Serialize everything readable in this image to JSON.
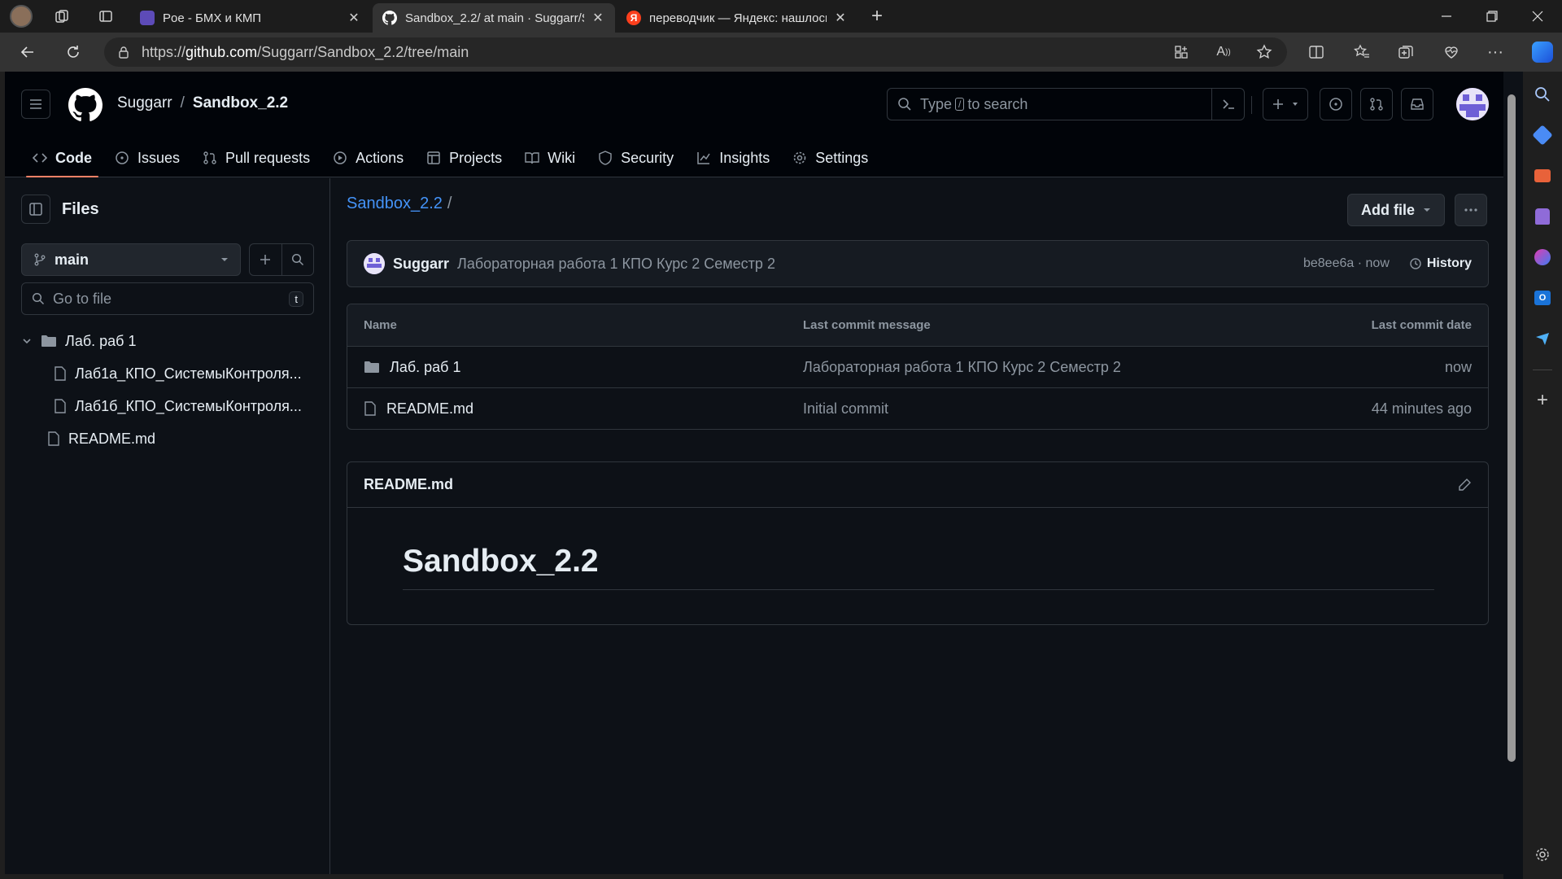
{
  "browser": {
    "tabs": [
      {
        "title": "Poe - БМХ и КМП",
        "favicon": "poe-icon",
        "active": false
      },
      {
        "title": "Sandbox_2.2/ at main · Suggarr/Sa",
        "favicon": "github-icon",
        "active": true
      },
      {
        "title": "переводчик — Яндекс: нашлось",
        "favicon": "yandex-icon",
        "active": false
      }
    ],
    "url_prefix": "https://",
    "url_host": "github.com",
    "url_path": "/Suggarr/Sandbox_2.2/tree/main"
  },
  "header": {
    "owner": "Suggarr",
    "separator": "/",
    "repo": "Sandbox_2.2",
    "search_prefix": "Type",
    "search_key": "/",
    "search_suffix": "to search"
  },
  "repo_nav": [
    {
      "label": "Code",
      "icon": "code-icon",
      "active": true
    },
    {
      "label": "Issues",
      "icon": "issue-icon"
    },
    {
      "label": "Pull requests",
      "icon": "pull-request-icon"
    },
    {
      "label": "Actions",
      "icon": "play-icon"
    },
    {
      "label": "Projects",
      "icon": "table-icon"
    },
    {
      "label": "Wiki",
      "icon": "book-icon"
    },
    {
      "label": "Security",
      "icon": "shield-icon"
    },
    {
      "label": "Insights",
      "icon": "graph-icon"
    },
    {
      "label": "Settings",
      "icon": "gear-icon"
    }
  ],
  "file_tree": {
    "title": "Files",
    "branch": "main",
    "goto_placeholder": "Go to file",
    "goto_key": "t",
    "items": [
      {
        "label": "Лаб. раб 1",
        "type": "folder",
        "expanded": true
      },
      {
        "label": "Лаб1а_КПО_СистемыКонтроля...",
        "type": "file"
      },
      {
        "label": "Лаб1б_КПО_СистемыКонтроля...",
        "type": "file"
      },
      {
        "label": "README.md",
        "type": "file"
      }
    ]
  },
  "main": {
    "breadcrumb_repo": "Sandbox_2.2",
    "breadcrumb_sep": "/",
    "add_file_label": "Add file",
    "commit": {
      "author": "Suggarr",
      "message": "Лабораторная работа 1 КПО Курс 2 Семестр 2",
      "hash": "be8ee6a",
      "meta_sep": "·",
      "time": "now",
      "history_label": "History"
    },
    "table": {
      "headers": [
        "Name",
        "Last commit message",
        "Last commit date"
      ],
      "rows": [
        {
          "name": "Лаб. раб 1",
          "type": "folder",
          "message": "Лабораторная работа 1 КПО Курс 2 Семестр 2",
          "date": "now"
        },
        {
          "name": "README.md",
          "type": "file",
          "message": "Initial commit",
          "date": "44 minutes ago"
        }
      ]
    },
    "readme": {
      "filename": "README.md",
      "heading": "Sandbox_2.2"
    }
  },
  "colors": {
    "accent_link": "#4493f8",
    "active_tab_underline": "#f78166",
    "page_bg": "#0d1117"
  }
}
